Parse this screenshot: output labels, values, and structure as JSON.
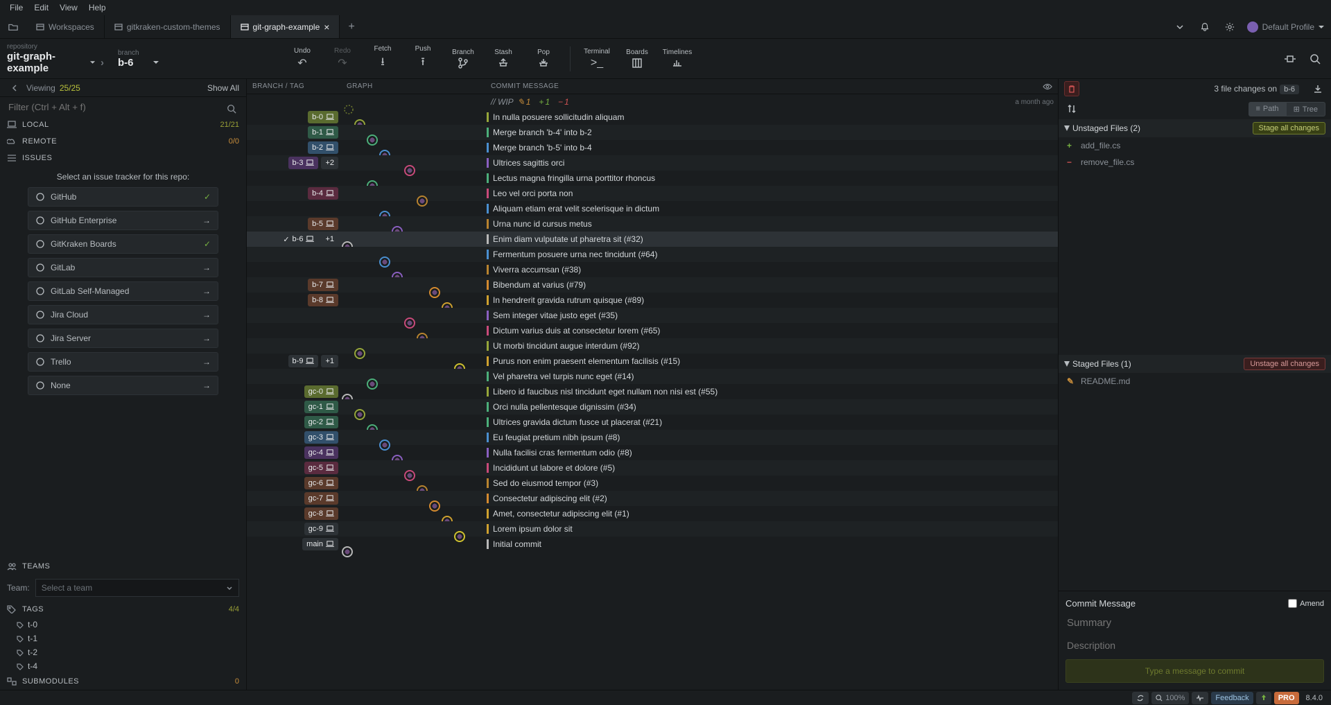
{
  "menu": [
    "File",
    "Edit",
    "View",
    "Help"
  ],
  "tabs": [
    {
      "label": "Workspaces",
      "closable": false,
      "active": false,
      "icon": "folder-icon"
    },
    {
      "label": "gitkraken-custom-themes",
      "closable": false,
      "active": false,
      "icon": "repo-icon"
    },
    {
      "label": "git-graph-example",
      "closable": true,
      "active": true,
      "icon": "repo-icon"
    }
  ],
  "profile_label": "Default Profile",
  "repo": {
    "repo_label": "repository",
    "repo_name": "git-graph-example",
    "branch_label": "branch",
    "branch_name": "b-6"
  },
  "toolbar": {
    "undo": "Undo",
    "redo": "Redo",
    "fetch": "Fetch",
    "push": "Push",
    "branch": "Branch",
    "stash": "Stash",
    "pop": "Pop",
    "terminal": "Terminal",
    "boards": "Boards",
    "timelines": "Timelines"
  },
  "left": {
    "viewing_label": "Viewing",
    "viewing_count": "25/25",
    "show_all": "Show All",
    "filter_placeholder": "Filter (Ctrl + Alt + f)",
    "local": {
      "label": "LOCAL",
      "count": "21/21"
    },
    "remote": {
      "label": "REMOTE",
      "count": "0/0"
    },
    "issues": {
      "label": "ISSUES"
    },
    "issue_prompt": "Select an issue tracker for this repo:",
    "trackers": [
      {
        "label": "GitHub",
        "check": true
      },
      {
        "label": "GitHub Enterprise",
        "check": false
      },
      {
        "label": "GitKraken Boards",
        "check": true
      },
      {
        "label": "GitLab",
        "check": false
      },
      {
        "label": "GitLab Self-Managed",
        "check": false
      },
      {
        "label": "Jira Cloud",
        "check": false
      },
      {
        "label": "Jira Server",
        "check": false
      },
      {
        "label": "Trello",
        "check": false
      },
      {
        "label": "None",
        "check": false
      }
    ],
    "teams": {
      "label": "TEAMS",
      "team_lbl": "Team:",
      "placeholder": "Select a team"
    },
    "tags": {
      "label": "TAGS",
      "count": "4/4",
      "items": [
        "t-0",
        "t-1",
        "t-2",
        "t-4"
      ]
    },
    "submodules": {
      "label": "SUBMODULES",
      "count": "0"
    }
  },
  "center": {
    "head_branch": "BRANCH / TAG",
    "head_graph": "GRAPH",
    "head_msg": "COMMIT MESSAGE",
    "wip_label": "// WIP",
    "wip_mod": "1",
    "wip_add": "1",
    "wip_del": "1",
    "wip_time": "a month ago",
    "commits": [
      {
        "tag": "b-0",
        "tagc": "#5a6b2f",
        "lane": 1,
        "msg": "In nulla posuere sollicitudin aliquam",
        "bar": "#96a63a"
      },
      {
        "tag": "b-1",
        "tagc": "#2f5a47",
        "lane": 2,
        "msg": "Merge branch 'b-4' into b-2",
        "bar": "#4caf7a"
      },
      {
        "tag": "b-2",
        "tagc": "#32506b",
        "lane": 3,
        "msg": "Merge branch 'b-5' into b-4",
        "bar": "#4a8fd0"
      },
      {
        "tag": "b-3",
        "tagc": "#4a325f",
        "extra": "+2",
        "lane": 5,
        "msg": "Ultrices sagittis orci",
        "bar": "#8a5fc0"
      },
      {
        "tag": "",
        "lane": 2,
        "msg": "Lectus magna fringilla urna porttitor rhoncus",
        "bar": "#4caf7a"
      },
      {
        "tag": "b-4",
        "tagc": "#5a2b3f",
        "lane": 6,
        "msg": "Leo vel orci porta non",
        "bar": "#c94a7a"
      },
      {
        "tag": "",
        "lane": 3,
        "msg": "Aliquam etiam erat velit scelerisque in dictum",
        "bar": "#4a8fd0"
      },
      {
        "tag": "b-5",
        "tagc": "#5a3a2b",
        "lane": 4,
        "msg": "Urna nunc id cursus metus",
        "bar": "#b8832f"
      },
      {
        "tag": "b-6",
        "tagc": "#2d3236",
        "extra": "+1",
        "chk": true,
        "lane": 0,
        "msg": "Enim diam vulputate ut pharetra sit (#32)",
        "bar": "#b8b8b8",
        "active": true
      },
      {
        "tag": "",
        "lane": 3,
        "msg": "Fermentum posuere urna nec tincidunt (#64)",
        "bar": "#4a8fd0"
      },
      {
        "tag": "",
        "lane": 4,
        "msg": "Viverra accumsan (#38)",
        "bar": "#b8832f"
      },
      {
        "tag": "b-7",
        "tagc": "#5a3a2b",
        "lane": 7,
        "msg": "Bibendum at varius (#79)",
        "bar": "#d48a2f"
      },
      {
        "tag": "b-8",
        "tagc": "#5a3a2b",
        "lane": 8,
        "msg": "In hendrerit gravida rutrum quisque (#89)",
        "bar": "#cfa12f"
      },
      {
        "tag": "",
        "lane": 5,
        "msg": "Sem integer vitae justo eget (#35)",
        "bar": "#8a5fc0"
      },
      {
        "tag": "",
        "lane": 6,
        "msg": "Dictum varius duis at consectetur lorem (#65)",
        "bar": "#c94a7a"
      },
      {
        "tag": "",
        "lane": 1,
        "msg": "Ut morbi tincidunt augue interdum (#92)",
        "bar": "#96a63a"
      },
      {
        "tag": "b-9",
        "tagc": "#2d3236",
        "extra": "+1",
        "lane": 9,
        "msg": "Purus non enim praesent elementum facilisis (#15)",
        "bar": "#cfa12f"
      },
      {
        "tag": "",
        "lane": 2,
        "msg": "Vel pharetra vel turpis nunc eget (#14)",
        "bar": "#4caf7a"
      },
      {
        "tag": "gc-0",
        "tagc": "#5a6b2f",
        "lane": 0,
        "msg": "Libero id faucibus nisl tincidunt eget nullam non nisi est (#55)",
        "bar": "#96a63a"
      },
      {
        "tag": "gc-1",
        "tagc": "#2f5a47",
        "lane": 1,
        "msg": "Orci nulla pellentesque dignissim (#34)",
        "bar": "#4caf7a"
      },
      {
        "tag": "gc-2",
        "tagc": "#2f5a47",
        "lane": 2,
        "msg": "Ultrices gravida dictum fusce ut placerat (#21)",
        "bar": "#4caf7a"
      },
      {
        "tag": "gc-3",
        "tagc": "#32506b",
        "lane": 3,
        "msg": "Eu feugiat pretium nibh ipsum (#8)",
        "bar": "#4a8fd0"
      },
      {
        "tag": "gc-4",
        "tagc": "#4a325f",
        "lane": 4,
        "msg": "Nulla facilisi cras fermentum odio (#8)",
        "bar": "#8a5fc0"
      },
      {
        "tag": "gc-5",
        "tagc": "#5a2b3f",
        "lane": 5,
        "msg": "Incididunt ut labore et dolore (#5)",
        "bar": "#c94a7a"
      },
      {
        "tag": "gc-6",
        "tagc": "#5a3a2b",
        "lane": 6,
        "msg": "Sed do eiusmod tempor (#3)",
        "bar": "#b8832f"
      },
      {
        "tag": "gc-7",
        "tagc": "#5a3a2b",
        "lane": 7,
        "msg": "Consectetur adipiscing elit (#2)",
        "bar": "#d48a2f"
      },
      {
        "tag": "gc-8",
        "tagc": "#5a3a2b",
        "lane": 8,
        "msg": "Amet, consectetur adipiscing elit (#1)",
        "bar": "#cfa12f"
      },
      {
        "tag": "gc-9",
        "tagc": "#2d3236",
        "lane": 9,
        "msg": "Lorem ipsum dolor sit",
        "bar": "#cfa12f"
      },
      {
        "tag": "main",
        "tagc": "#2d3236",
        "lane": 0,
        "msg": "Initial commit",
        "bar": "#b8b8b8"
      }
    ],
    "lanecolors": [
      "#b8b8b8",
      "#96a63a",
      "#4caf7a",
      "#4a8fd0",
      "#8a5fc0",
      "#c94a7a",
      "#b8832f",
      "#d48a2f",
      "#cfa12f",
      "#d0c22f"
    ]
  },
  "right": {
    "changes_text": "3 file changes on",
    "branch": "b-6",
    "path": "Path",
    "tree": "Tree",
    "unstaged": {
      "label": "Unstaged Files (2)",
      "btn": "Stage all changes",
      "files": [
        {
          "t": "add",
          "n": "add_file.cs"
        },
        {
          "t": "del",
          "n": "remove_file.cs"
        }
      ]
    },
    "staged": {
      "label": "Staged Files (1)",
      "btn": "Unstage all changes",
      "files": [
        {
          "t": "mod",
          "n": "README.md"
        }
      ]
    },
    "commit": {
      "title": "Commit Message",
      "amend": "Amend",
      "summary_ph": "Summary",
      "desc_ph": "Description",
      "btn": "Type a message to commit"
    }
  },
  "footer": {
    "zoom": "100%",
    "feedback": "Feedback",
    "pro": "PRO",
    "version": "8.4.0"
  }
}
